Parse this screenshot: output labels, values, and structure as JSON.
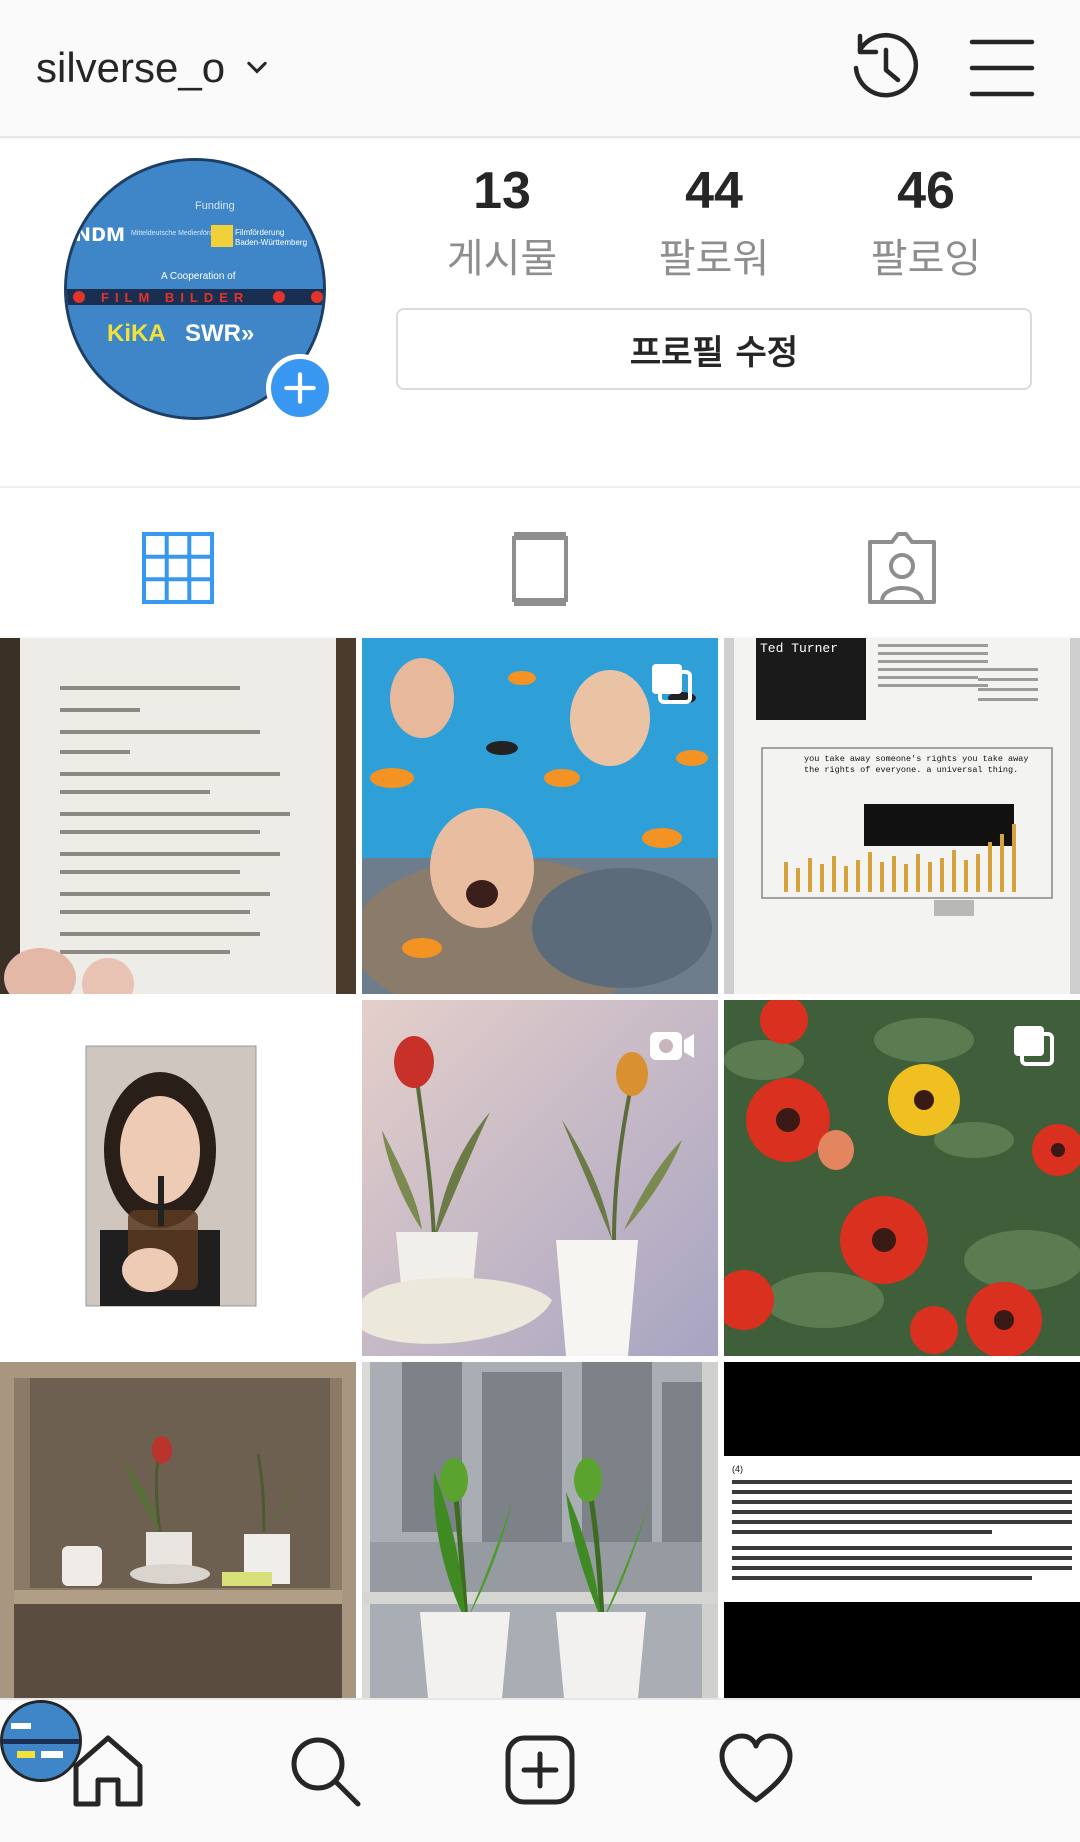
{
  "header": {
    "username": "silverse_o"
  },
  "profile": {
    "avatar_text": {
      "funding": "Funding",
      "mdm": "Mitteldeutsche Medienförderung",
      "mfg": "Filmförderung Baden-Württemberg",
      "cooperation": "A Cooperation of",
      "filmbilder": "FILM BILDER",
      "kika": "KiKA",
      "swr": "SWR»"
    },
    "stats": [
      {
        "value": "13",
        "label": "게시물"
      },
      {
        "value": "44",
        "label": "팔로워"
      },
      {
        "value": "46",
        "label": "팔로잉"
      }
    ],
    "edit_button": "프로필 수정"
  },
  "tabs": [
    {
      "icon": "grid-icon"
    },
    {
      "icon": "igtv-icon"
    },
    {
      "icon": "tagged-icon"
    }
  ],
  "posts": [
    {
      "kind": "book-page",
      "badge": ""
    },
    {
      "kind": "fish-collage",
      "badge": "multiple"
    },
    {
      "kind": "typography-page",
      "badge": "",
      "heading": "Ted Turner",
      "quote": "you take away someone's rights you take away the rights of everyone. a universal thing."
    },
    {
      "kind": "portrait",
      "badge": ""
    },
    {
      "kind": "tulips-pink",
      "badge": "video"
    },
    {
      "kind": "gazania-flowers",
      "badge": "multiple"
    },
    {
      "kind": "tulips-shelf",
      "badge": ""
    },
    {
      "kind": "tulips-window",
      "badge": ""
    },
    {
      "kind": "text-screenshot",
      "badge": "",
      "number": "(4)"
    }
  ],
  "bottom_nav": [
    "home-icon",
    "search-icon",
    "add-post-icon",
    "heart-icon",
    "profile-avatar"
  ]
}
